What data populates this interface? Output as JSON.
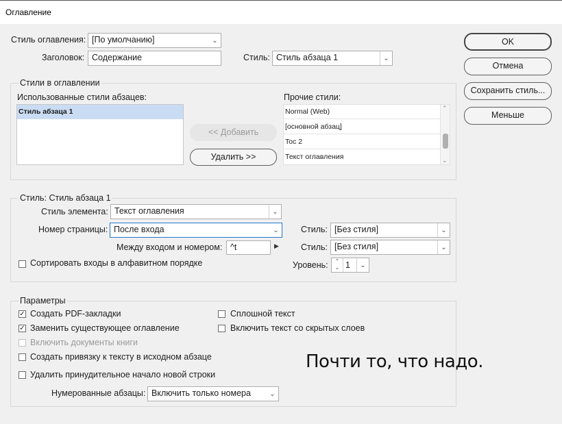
{
  "window": {
    "title": "Оглавление"
  },
  "toc": {
    "style_label": "Стиль оглавления:",
    "style_value": "[По умолчанию]",
    "heading_label": "Заголовок:",
    "heading_value": "Содержание",
    "heading_style_label": "Стиль:",
    "heading_style_value": "Стиль абзаца 1"
  },
  "buttons": {
    "ok": "OK",
    "cancel": "Отмена",
    "save_style": "Сохранить стиль...",
    "fewer": "Меньше",
    "add": "<< Добавить",
    "remove": "Удалить >>"
  },
  "styles_in_toc": {
    "title": "Стили в оглавлении",
    "used_label": "Использованные стили абзацев:",
    "used": [
      "Стиль абзаца 1"
    ],
    "other_label": "Прочие стили:",
    "other": [
      "Normal (Web)",
      "[основной абзац]",
      "Toc 2",
      "Текст оглавления"
    ]
  },
  "style_section": {
    "title": "Стиль: Стиль абзаца 1",
    "entry_style_label": "Стиль элемента:",
    "entry_style_value": "Текст оглавления",
    "page_number_label": "Номер страницы:",
    "page_number_value": "После входа",
    "page_style_label": "Стиль:",
    "page_style_value": "[Без стиля]",
    "between_label": "Между входом и номером:",
    "between_value": "^t",
    "between_style_label": "Стиль:",
    "between_style_value": "[Без стиля]",
    "sort_label": "Сортировать входы в алфавитном порядке",
    "sort_checked": false,
    "level_label": "Уровень:",
    "level_value": "1"
  },
  "options": {
    "title": "Параметры",
    "create_pdf_bookmarks": {
      "label": "Создать PDF-закладки",
      "checked": true
    },
    "replace_existing": {
      "label": "Заменить существующее оглавление",
      "checked": true
    },
    "include_book_docs": {
      "label": "Включить документы книги",
      "checked": false,
      "disabled": true
    },
    "create_anchor": {
      "label": "Создать привязку к тексту в исходном абзаце",
      "checked": false
    },
    "remove_forced_break": {
      "label": "Удалить принудительное начало новой строки",
      "checked": false
    },
    "run_in": {
      "label": "Сплошной текст",
      "checked": false
    },
    "include_hidden_layers": {
      "label": "Включить текст со скрытых слоев",
      "checked": false
    },
    "numbered_label": "Нумерованные абзацы:",
    "numbered_value": "Включить только номера"
  },
  "annotation": "Почти то, что надо."
}
